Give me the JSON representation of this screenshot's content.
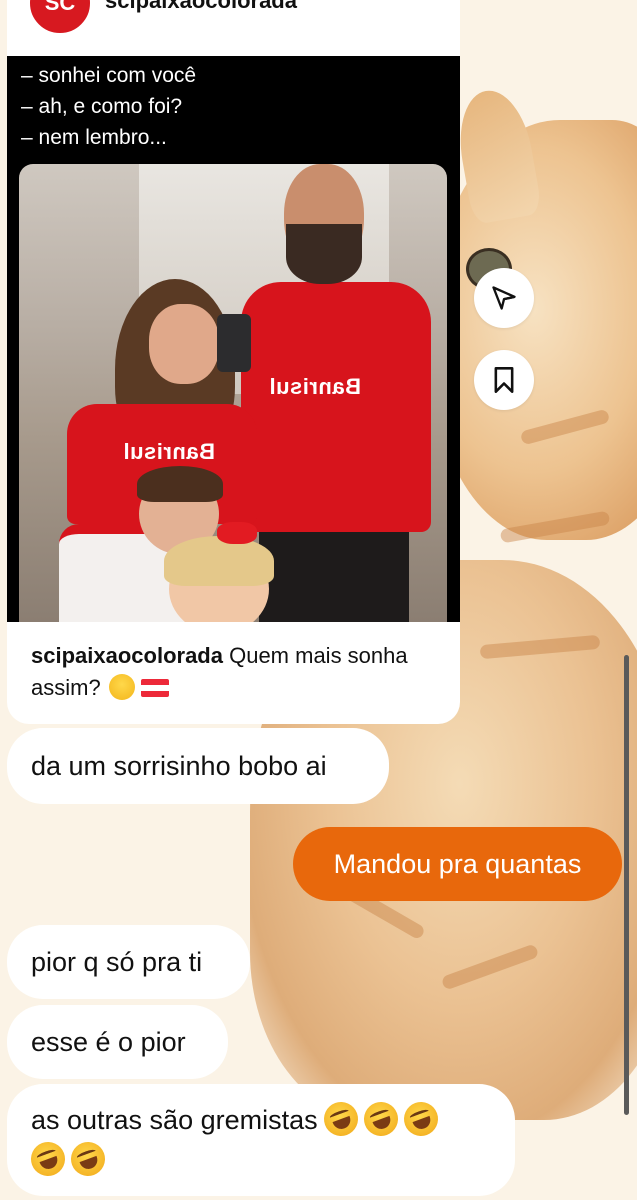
{
  "post": {
    "username": "scipaixaocolorada",
    "avatar_label": "SC",
    "meme_lines": [
      "– sonhei com você",
      "– ah, e como foi?",
      "– nem lembro..."
    ],
    "shirt_text_1": "Banrisul",
    "shirt_text_2": "Banrisul",
    "caption_username": "scipaixaocolorada",
    "caption_text": " Quem mais sonha assim?"
  },
  "actions": {
    "share_icon": "send-icon",
    "save_icon": "bookmark-icon"
  },
  "messages": [
    {
      "from": "them",
      "text": "da um sorrisinho bobo ai"
    },
    {
      "from": "me",
      "text": "Mandou pra quantas"
    },
    {
      "from": "them",
      "text": "pior q só pra ti"
    },
    {
      "from": "them",
      "text": "esse é o pior"
    },
    {
      "from": "them",
      "text": "as outras são gremistas"
    }
  ],
  "colors": {
    "outgoing_bubble": "#e8680c",
    "incoming_bubble": "#ffffff",
    "background": "#fbf3e6",
    "club_red": "#d7141c"
  }
}
